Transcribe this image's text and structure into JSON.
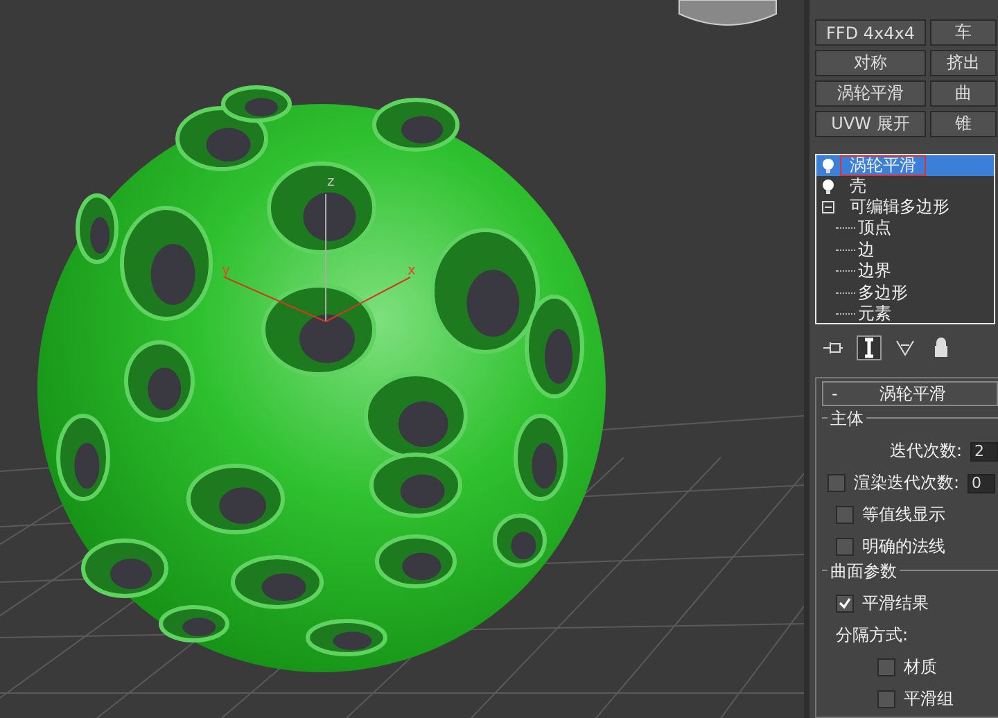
{
  "viewport": {
    "axis_labels": [
      "z",
      "y",
      "x"
    ]
  },
  "modifier_buttons": [
    {
      "label": "FFD 4x4x4"
    },
    {
      "label": "车"
    },
    {
      "label": "对称"
    },
    {
      "label": "挤出"
    },
    {
      "label": "涡轮平滑"
    },
    {
      "label": "曲"
    },
    {
      "label": "UVW 展开"
    },
    {
      "label": "锥"
    }
  ],
  "stack": [
    {
      "label": "涡轮平滑",
      "kind": "modifier",
      "selected": true,
      "annotated": true
    },
    {
      "label": "壳",
      "kind": "modifier",
      "selected": false,
      "annotated": false
    },
    {
      "label": "可编辑多边形",
      "kind": "object",
      "selected": false,
      "annotated": false,
      "expanded": true,
      "children": [
        {
          "label": "顶点"
        },
        {
          "label": "边"
        },
        {
          "label": "边界"
        },
        {
          "label": "多边形"
        },
        {
          "label": "元素"
        }
      ]
    }
  ],
  "stack_tools": [
    {
      "kind": "pin",
      "selected": false
    },
    {
      "kind": "ibeam",
      "selected": true
    },
    {
      "kind": "funnel",
      "selected": false
    },
    {
      "kind": "lock",
      "selected": false
    }
  ],
  "rollout": {
    "collapse_sign": "-",
    "title": "涡轮平滑",
    "groups": [
      {
        "title": "主体",
        "items": [
          {
            "kind": "spinner",
            "label": "迭代次数:",
            "value": "2"
          },
          {
            "kind": "check-spinner",
            "label": "渲染迭代次数:",
            "value": "0",
            "checked": false
          },
          {
            "kind": "checkbox",
            "label": "等值线显示",
            "checked": false
          },
          {
            "kind": "checkbox",
            "label": "明确的法线",
            "checked": false
          }
        ]
      },
      {
        "title": "曲面参数",
        "items": [
          {
            "kind": "checkbox",
            "label": "平滑结果",
            "checked": true
          },
          {
            "kind": "heading",
            "label": "分隔方式:"
          },
          {
            "kind": "subcheckbox",
            "label": "材质",
            "checked": false
          },
          {
            "kind": "subcheckbox",
            "label": "平滑组",
            "checked": false
          }
        ]
      }
    ]
  }
}
